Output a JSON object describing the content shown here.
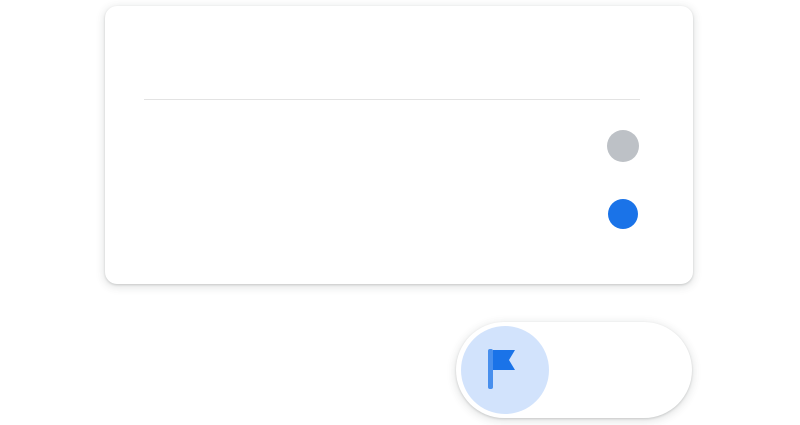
{
  "card": {
    "options": [
      {
        "name": "option-unselected",
        "color": "#bdc1c6"
      },
      {
        "name": "option-selected",
        "color": "#1a73e8"
      }
    ]
  },
  "fab": {
    "icon": "flag-icon",
    "icon_color": "#1a73e8",
    "circle_color": "#d2e3fc"
  }
}
